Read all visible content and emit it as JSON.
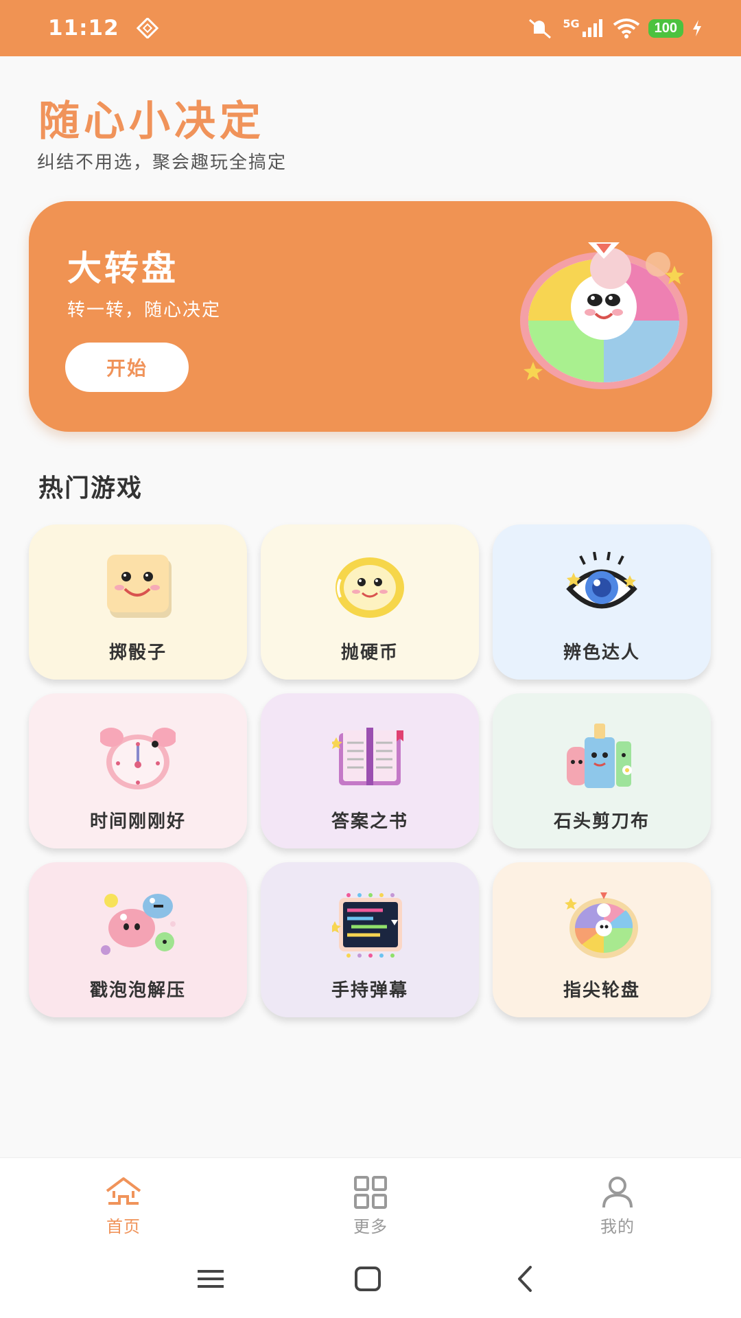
{
  "status": {
    "time": "11:12",
    "network": "5G",
    "battery": "100"
  },
  "header": {
    "title": "随心小决定",
    "subtitle": "纠结不用选，聚会趣玩全搞定"
  },
  "hero": {
    "title": "大转盘",
    "description": "转一转，随心决定",
    "button_label": "开始"
  },
  "section": {
    "title": "热门游戏"
  },
  "games": [
    {
      "label": "掷骰子",
      "icon": "dice-icon",
      "bg": "#fdf6e0"
    },
    {
      "label": "抛硬币",
      "icon": "coin-icon",
      "bg": "#fdf8e6"
    },
    {
      "label": "辨色达人",
      "icon": "eye-icon",
      "bg": "#e8f2fd"
    },
    {
      "label": "时间刚刚好",
      "icon": "alarm-clock-icon",
      "bg": "#fcedf0"
    },
    {
      "label": "答案之书",
      "icon": "book-icon",
      "bg": "#f3e6f6"
    },
    {
      "label": "石头剪刀布",
      "icon": "rock-paper-scissors-icon",
      "bg": "#ecf5ef"
    },
    {
      "label": "戳泡泡解压",
      "icon": "bubbles-icon",
      "bg": "#fbe6ec"
    },
    {
      "label": "手持弹幕",
      "icon": "danmaku-screen-icon",
      "bg": "#eee8f5"
    },
    {
      "label": "指尖轮盘",
      "icon": "spin-wheel-icon",
      "bg": "#fdf1e3"
    }
  ],
  "nav": {
    "home": "首页",
    "more": "更多",
    "mine": "我的"
  },
  "colors": {
    "accent": "#f09353",
    "nav_active": "#f0935a",
    "nav_inactive": "#999999"
  }
}
